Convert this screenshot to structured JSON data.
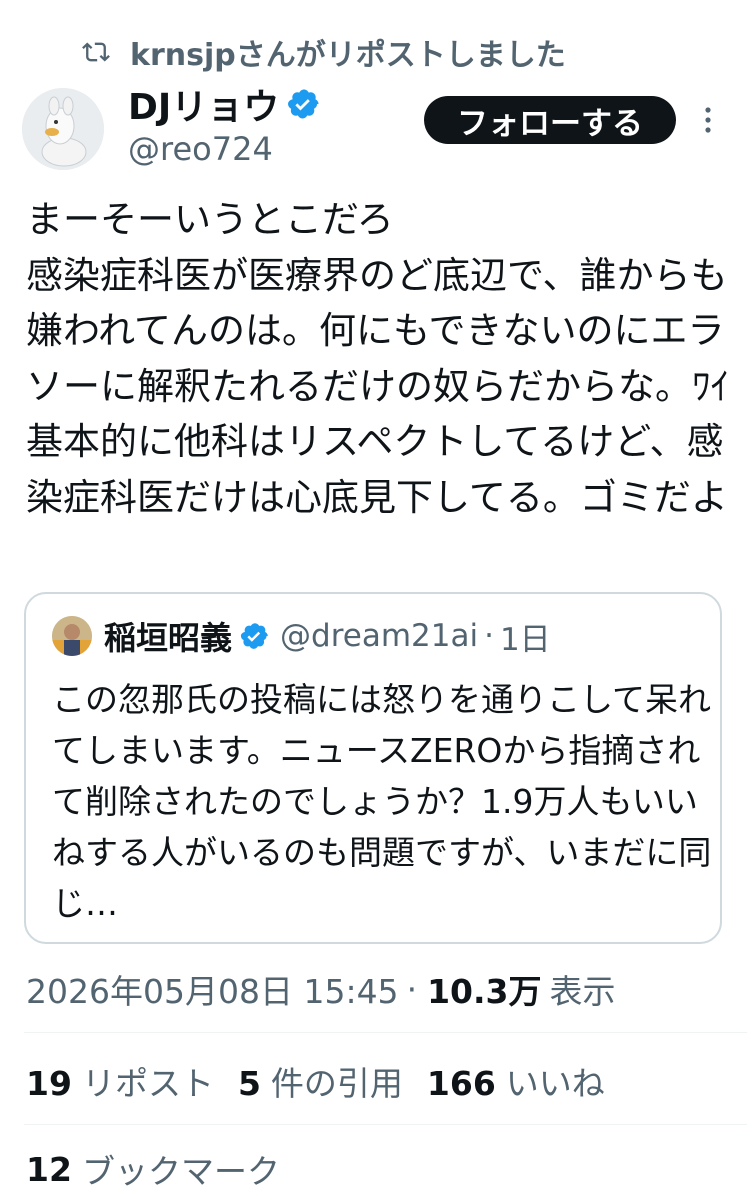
{
  "repost": {
    "icon": "repost-icon",
    "text": "krnsjpさんがリポストしました"
  },
  "author": {
    "name": "DJリョウ",
    "handle": "@reo724",
    "verified": true,
    "verified_color": "#1d9bf0",
    "avatar": "avatar-image"
  },
  "follow": {
    "label": "フォローする"
  },
  "post": {
    "body": "まーそーいうとこだろ\n感染症科医が医療界のど底辺で、誰からも嫌われてんのは。何にもできないのにエラソーに解釈たれるだけの奴らだからな。ﾜｲ基本的に他科はリスペクトしてるけど、感染症科医だけは心底見下してる。ゴミだよ"
  },
  "quote": {
    "name": "稲垣昭義",
    "verified": true,
    "handle": "@dream21ai",
    "dot": "·",
    "time": "1日",
    "body": "この忽那氏の投稿には怒りを通りこして呆れてしまいます。ニュースZEROから指摘されて削除されたのでしょうか？1.9万人もいいねする人がいるのも問題ですが、いまだに同じ…"
  },
  "meta": {
    "timestamp": "2026年05月08日 15:45",
    "dot": "·",
    "views": "10.3万",
    "views_label": "表示"
  },
  "stats": {
    "reposts": {
      "count": "19",
      "label": "リポスト"
    },
    "quotes": {
      "count": "5",
      "label": "件の引用"
    },
    "likes": {
      "count": "166",
      "label": "いいね"
    },
    "bookmarks": {
      "count": "12",
      "label": "ブックマーク"
    }
  },
  "colors": {
    "text": "#0f1419",
    "secondary": "#536471",
    "border": "#cfd9de",
    "verified": "#1d9bf0"
  }
}
